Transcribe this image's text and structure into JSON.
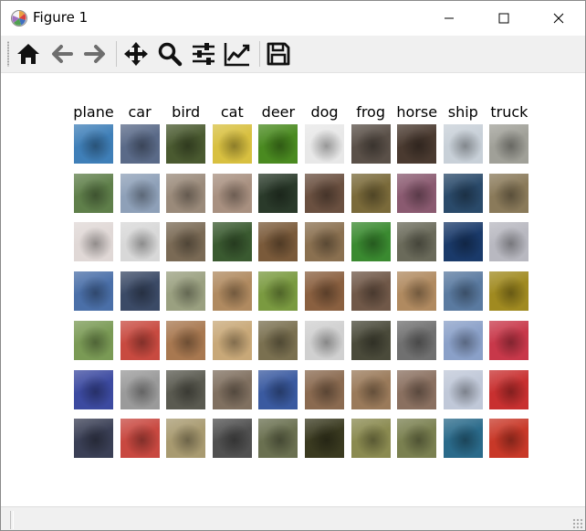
{
  "window": {
    "title": "Figure 1"
  },
  "toolbar": {
    "buttons": [
      {
        "icon": "home-icon"
      },
      {
        "icon": "back-arrow-icon"
      },
      {
        "icon": "forward-arrow-icon"
      },
      {
        "icon": "pan-icon"
      },
      {
        "icon": "zoom-icon"
      },
      {
        "icon": "subplots-icon"
      },
      {
        "icon": "edit-axes-icon"
      },
      {
        "icon": "save-icon"
      }
    ]
  },
  "figure": {
    "classes": [
      "plane",
      "car",
      "bird",
      "cat",
      "deer",
      "dog",
      "frog",
      "horse",
      "ship",
      "truck"
    ],
    "samples_per_class": 7,
    "thumbnail_colors": [
      [
        "#3f7fb8",
        "#5f7f4a",
        "#e0d8d6",
        "#4a6fa8",
        "#7a9a55",
        "#3c4aa0",
        "#3a3f55"
      ],
      [
        "#5a6a88",
        "#8ea0b8",
        "#d8d8d8",
        "#3b4a66",
        "#c84a40",
        "#9a9a9a",
        "#c84840"
      ],
      [
        "#4a5a30",
        "#9a8a7a",
        "#7a6a55",
        "#9aa080",
        "#a87850",
        "#5a5a50",
        "#a89a70"
      ],
      [
        "#d8c040",
        "#a89080",
        "#3a5a30",
        "#b08a60",
        "#c8a878",
        "#807060",
        "#505050"
      ],
      [
        "#4a8a20",
        "#2a3a2a",
        "#7a5a3a",
        "#7a9a40",
        "#7a7050",
        "#3a5aa0",
        "#6a7050"
      ],
      [
        "#e8e8e8",
        "#6a5040",
        "#8a7050",
        "#8a6040",
        "#d0d0d0",
        "#8a6a50",
        "#3a3a20"
      ],
      [
        "#5a5048",
        "#7a6a3a",
        "#3a8a30",
        "#705848",
        "#4a4a3a",
        "#9a7a5a",
        "#8a8a50"
      ],
      [
        "#4a3a30",
        "#8a5a70",
        "#6a6a5a",
        "#b08a60",
        "#707070",
        "#8a7060",
        "#7a8050"
      ],
      [
        "#c8d0d8",
        "#2a4a6a",
        "#1a3a6a",
        "#5a7aa0",
        "#8aa0c8",
        "#c0c8d8",
        "#2a6a8a"
      ],
      [
        "#a0a098",
        "#8a7a5a",
        "#b8b8c0",
        "#a08a20",
        "#c8384a",
        "#c83030",
        "#c83828"
      ]
    ]
  }
}
